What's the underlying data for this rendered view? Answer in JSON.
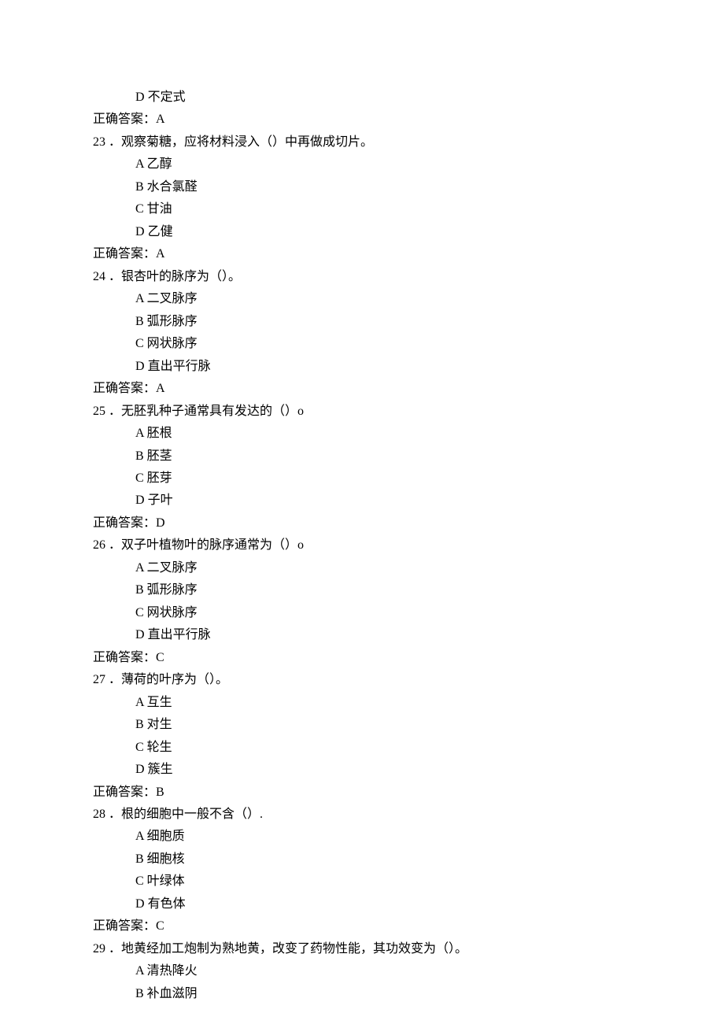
{
  "questions": [
    {
      "number": "",
      "stem": "",
      "options": [
        {
          "label": "D",
          "text": "不定式"
        }
      ],
      "answer_label": "正确答案：",
      "answer": "A"
    },
    {
      "number": "23",
      "stem": "．观察菊糖，应将材料浸入（）中再做成切片。",
      "options": [
        {
          "label": "A",
          "text": "乙醇"
        },
        {
          "label": "B",
          "text": "水合氯醛"
        },
        {
          "label": "C",
          "text": "甘油"
        },
        {
          "label": "D",
          "text": "乙健"
        }
      ],
      "answer_label": "正确答案：",
      "answer": "A"
    },
    {
      "number": "24",
      "stem": "．银杏叶的脉序为（）。",
      "options": [
        {
          "label": "A",
          "text": "二叉脉序"
        },
        {
          "label": "B",
          "text": "弧形脉序"
        },
        {
          "label": "C",
          "text": "网状脉序"
        },
        {
          "label": "D",
          "text": "直出平行脉"
        }
      ],
      "answer_label": "正确答案：",
      "answer": "A"
    },
    {
      "number": "25",
      "stem": "．无胚乳种子通常具有发达的（）o",
      "options": [
        {
          "label": "A",
          "text": "胚根"
        },
        {
          "label": "B",
          "text": "胚茎"
        },
        {
          "label": "C",
          "text": "胚芽"
        },
        {
          "label": "D",
          "text": "子叶"
        }
      ],
      "answer_label": "正确答案：",
      "answer": "D"
    },
    {
      "number": "26",
      "stem": "．双子叶植物叶的脉序通常为（）o",
      "options": [
        {
          "label": "A",
          "text": "二叉脉序"
        },
        {
          "label": "B",
          "text": "弧形脉序"
        },
        {
          "label": "C",
          "text": "网状脉序"
        },
        {
          "label": "D",
          "text": "直出平行脉"
        }
      ],
      "answer_label": "正确答案：",
      "answer": "C"
    },
    {
      "number": "27",
      "stem": "．薄荷的叶序为（）。",
      "options": [
        {
          "label": "A",
          "text": "互生"
        },
        {
          "label": "B",
          "text": "对生"
        },
        {
          "label": "C",
          "text": "轮生"
        },
        {
          "label": "D",
          "text": "簇生"
        }
      ],
      "answer_label": "正确答案：",
      "answer": "B"
    },
    {
      "number": "28",
      "stem": "．根的细胞中一般不含（）.",
      "options": [
        {
          "label": "A",
          "text": "细胞质"
        },
        {
          "label": "B",
          "text": "细胞核"
        },
        {
          "label": "C",
          "text": "叶绿体"
        },
        {
          "label": "D",
          "text": "有色体"
        }
      ],
      "answer_label": "正确答案：",
      "answer": "C"
    },
    {
      "number": "29",
      "stem": "．地黄经加工炮制为熟地黄，改变了药物性能，其功效变为（）。",
      "options": [
        {
          "label": "A",
          "text": "清热降火"
        },
        {
          "label": "B",
          "text": "补血滋阴"
        }
      ],
      "answer_label": "",
      "answer": ""
    }
  ]
}
